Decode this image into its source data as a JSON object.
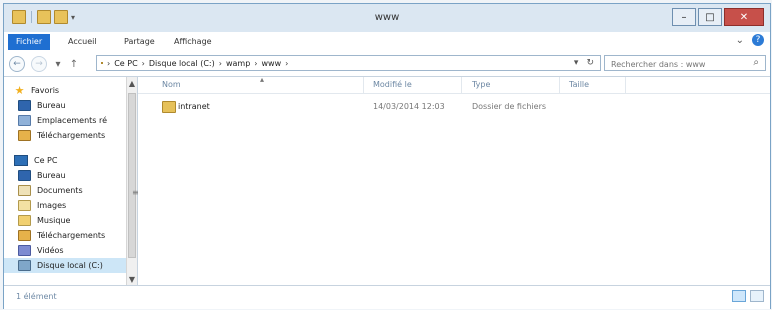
{
  "window": {
    "title": "www",
    "controls": {
      "minimize": "–",
      "maximize": "□",
      "close": "✕"
    }
  },
  "ribbon": {
    "tabs": [
      "Fichier",
      "Accueil",
      "Partage",
      "Affichage"
    ]
  },
  "address": {
    "crumbs": [
      "Ce PC",
      "Disque local (C:)",
      "wamp",
      "www"
    ],
    "search_placeholder": "Rechercher dans : www"
  },
  "nav": {
    "favorites_label": "Favoris",
    "favorites": [
      "Bureau",
      "Emplacements ré",
      "Téléchargements"
    ],
    "pc_label": "Ce PC",
    "pc_items": [
      "Bureau",
      "Documents",
      "Images",
      "Musique",
      "Téléchargements",
      "Vidéos",
      "Disque local (C:)"
    ]
  },
  "columns": {
    "name": "Nom",
    "modified": "Modifié le",
    "type": "Type",
    "size": "Taille"
  },
  "files": [
    {
      "name": "intranet",
      "modified": "14/03/2014 12:03",
      "type": "Dossier de fichiers",
      "size": ""
    }
  ],
  "status": {
    "count": "1 élément"
  },
  "icons": {
    "folder": "folder-icon",
    "search": "search-icon",
    "help": "help-icon"
  }
}
